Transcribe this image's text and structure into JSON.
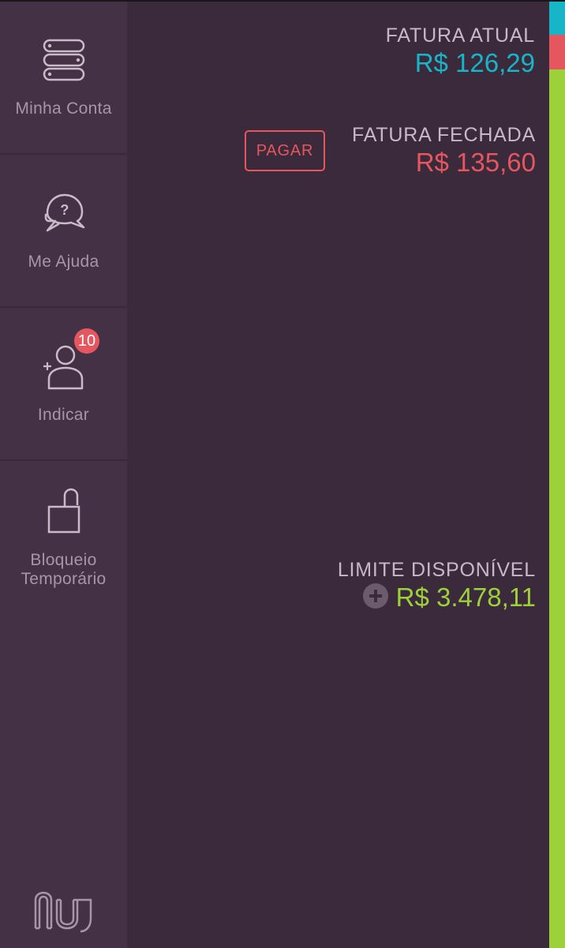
{
  "sidebar": {
    "items": [
      {
        "label": "Minha Conta",
        "icon": "server-stack-icon"
      },
      {
        "label": "Me Ajuda",
        "icon": "help-chat-icon"
      },
      {
        "label": "Indicar",
        "icon": "add-person-icon",
        "badge": "10"
      },
      {
        "label": "Bloqueio Temporário",
        "icon": "unlocked-padlock-icon"
      }
    ],
    "logo": "nu"
  },
  "invoice_current": {
    "caption": "FATURA ATUAL",
    "amount": "R$ 126,29"
  },
  "invoice_closed": {
    "caption": "FATURA FECHADA",
    "amount": "R$ 135,60",
    "pay_label": "PAGAR"
  },
  "limit": {
    "caption": "LIMITE DISPONÍVEL",
    "amount": "R$ 3.478,11"
  },
  "credit_bar": {
    "segments": [
      {
        "name": "current",
        "color": "#18b5c8"
      },
      {
        "name": "closed",
        "color": "#e5575e"
      },
      {
        "name": "available",
        "color": "#9cd13a"
      }
    ]
  },
  "colors": {
    "background": "#3b2a3c",
    "sidebar": "#443145",
    "cyan": "#18b5c8",
    "red": "#e5575e",
    "green": "#9cd13a"
  }
}
